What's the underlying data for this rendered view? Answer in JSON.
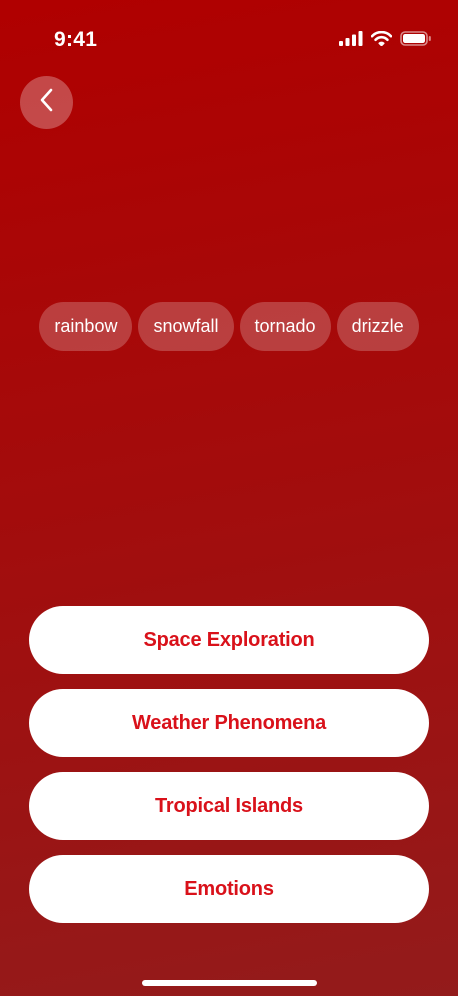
{
  "status_bar": {
    "time": "9:41"
  },
  "icons": {
    "back": "chevron-left-icon",
    "signal": "signal-icon",
    "wifi": "wifi-icon",
    "battery": "battery-icon"
  },
  "colors": {
    "background_top": "#b00000",
    "background_bottom": "#931b1b",
    "button_bg": "#ffffff",
    "button_text": "#d9111a"
  },
  "words": [
    "rainbow",
    "snowfall",
    "tornado",
    "drizzle"
  ],
  "options": [
    "Space Exploration",
    "Weather Phenomena",
    "Tropical Islands",
    "Emotions"
  ]
}
